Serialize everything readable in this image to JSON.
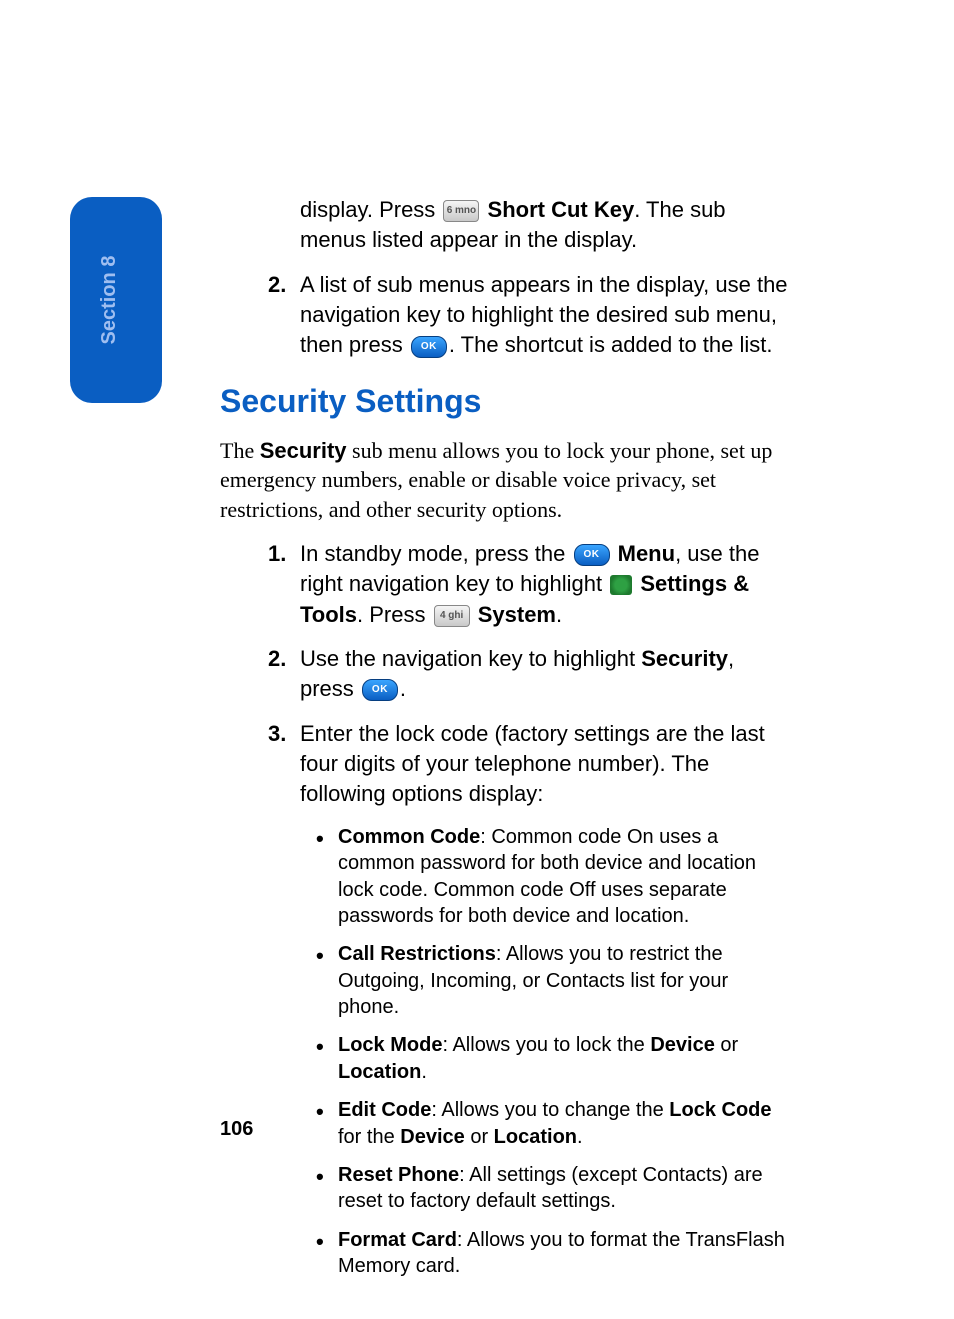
{
  "tab": {
    "label": "Section 8"
  },
  "page_number": "106",
  "intro": {
    "pre_key": "display. Press ",
    "key6_label": "6 mno",
    "shortcut_bold": " Short Cut Key",
    "post_key": ". The sub menus listed appear in the display."
  },
  "step2_top": {
    "num": "2.",
    "pre": "A list of sub menus appears in the display, use the navigation key to highlight the desired sub menu, then press ",
    "ok_label": "OK",
    "post": ". The shortcut is added to the list."
  },
  "heading": "Security Settings",
  "paragraph": {
    "pre": "The ",
    "bold": "Security",
    "post": " sub menu allows you to lock your phone, set up emergency numbers, enable or disable voice privacy, set restrictions, and other security options."
  },
  "sec_steps": {
    "s1": {
      "num": "1.",
      "a": "In standby mode, press the ",
      "ok": "OK",
      "b_menu": " Menu",
      "b": ", use the right navigation key to highlight ",
      "b_settings": " Settings & Tools",
      "c": ". Press ",
      "key4_label": "4 ghi",
      "b_system": " System",
      "d": "."
    },
    "s2": {
      "num": "2.",
      "a": "Use the navigation key to highlight ",
      "b_security": "Security",
      "b": ", press ",
      "ok": "OK",
      "c": "."
    },
    "s3": {
      "num": "3.",
      "a": "Enter the lock code (factory settings are the last four digits of your telephone number). The following options display:"
    }
  },
  "bullets": {
    "b1": {
      "t": "Common Code",
      "r": ": Common code On uses a common password for both device and location lock code. Common code Off uses separate passwords for both device and location."
    },
    "b2": {
      "t": "Call Restrictions",
      "r": ": Allows you to restrict the Outgoing, Incoming, or Contacts list for your phone."
    },
    "b3": {
      "t": "Lock Mode",
      "r1": ": Allows you to lock the ",
      "d": "Device",
      "r2": " or ",
      "l": "Location",
      "r3": "."
    },
    "b4": {
      "t": "Edit Code",
      "r1": ": Allows you to change the ",
      "lc": "Lock Code",
      "r2": " for the ",
      "d": "Device",
      "r3": " or ",
      "l": "Location",
      "r4": "."
    },
    "b5": {
      "t": "Reset Phone",
      "r": ": All settings (except Contacts) are reset to factory default settings."
    },
    "b6": {
      "t": "Format Card",
      "r": ": Allows you to format the TransFlash Memory card."
    }
  }
}
